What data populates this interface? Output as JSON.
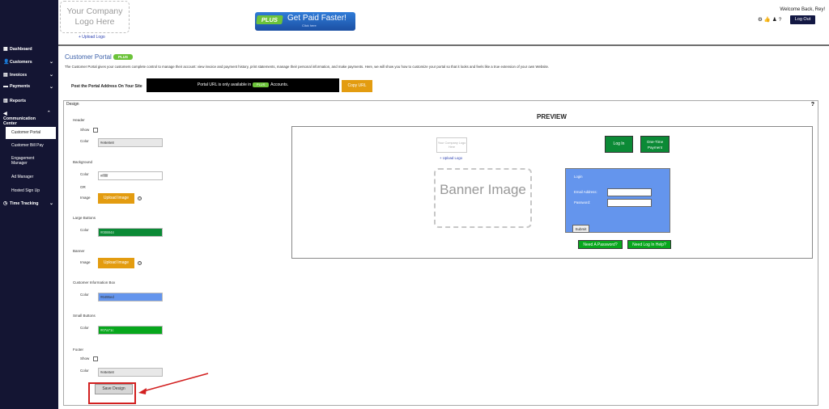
{
  "sidebar": {
    "items": [
      {
        "label": "Dashboard",
        "icon": "grid-icon"
      },
      {
        "label": "Customers",
        "icon": "user-icon"
      },
      {
        "label": "Invoices",
        "icon": "invoice-icon"
      },
      {
        "label": "Payments",
        "icon": "payments-icon"
      },
      {
        "label": "Reports",
        "icon": "chart-icon"
      },
      {
        "label": "Communication Center",
        "icon": "megaphone-icon"
      },
      {
        "label": "Time Tracking",
        "icon": "clock-icon"
      }
    ],
    "subitems": [
      "Customer Portal",
      "Customer Bill Pay",
      "Engagement Manager",
      "Ad Manager",
      "Hosted Sign Up"
    ]
  },
  "header": {
    "logo_text": "Your Company Logo Here",
    "upload_logo": "+ Upload Logo",
    "promo_plus": "PLUS",
    "promo_main": "Get Paid Faster!",
    "promo_sub": "Click here",
    "welcome": "Welcome Back, Rey!",
    "logout": "Log Out"
  },
  "page": {
    "title": "Customer Portal",
    "plus_badge": "PLUS",
    "description": "The Customer Portal gives your customers complete control to manage their account: view invoice and payment history, print statements, manage their personal information, and make payments. Here, we will show you how to customize your portal so that it looks and feels like a true extension of your own Website.",
    "post_label": "Post the Portal Address On Your Site",
    "url_notice_a": "Portal URL is only available in",
    "url_notice_plus": "PLUS",
    "url_notice_b": "Accounts.",
    "copy_url": "Copy URL"
  },
  "design": {
    "heading": "Design",
    "help": "?",
    "header_section": "Header",
    "show_label": "Show",
    "color_label": "Color",
    "header_color": "#e8e8e8",
    "background_section": "Background",
    "background_color": "#ffffff",
    "or_label": "OR",
    "image_label": "Image",
    "upload_image": "Upload Image",
    "large_buttons_section": "Large Buttons",
    "large_buttons_color": "#008844",
    "banner_section": "Banner",
    "customer_info_section": "Customer Information Box",
    "customer_info_color": "#6495ed",
    "small_buttons_section": "Small Buttons",
    "small_buttons_color": "#07a71c",
    "footer_section": "Footer",
    "footer_color": "#e8e8e8",
    "save_design": "Save Design"
  },
  "preview": {
    "title": "PREVIEW",
    "logo_text": "Your Company Logo Here",
    "upload_logo": "+ Upload Logo",
    "banner_text": "Banner Image",
    "login_btn": "Log In",
    "one_time_btn": "One-Time Payment",
    "login_heading": "Login",
    "email_label": "Email Address:",
    "password_label": "Password:",
    "submit": "Submit",
    "need_password": "Need A Password?",
    "need_help": "Need Log In Help?"
  },
  "colors": {
    "sidebar_bg": "#141533",
    "accent_orange": "#e39c10",
    "green": "#0b8a36",
    "blue_box": "#6495ed",
    "plus_green": "#6cc33a",
    "highlight_red": "#d22020"
  }
}
